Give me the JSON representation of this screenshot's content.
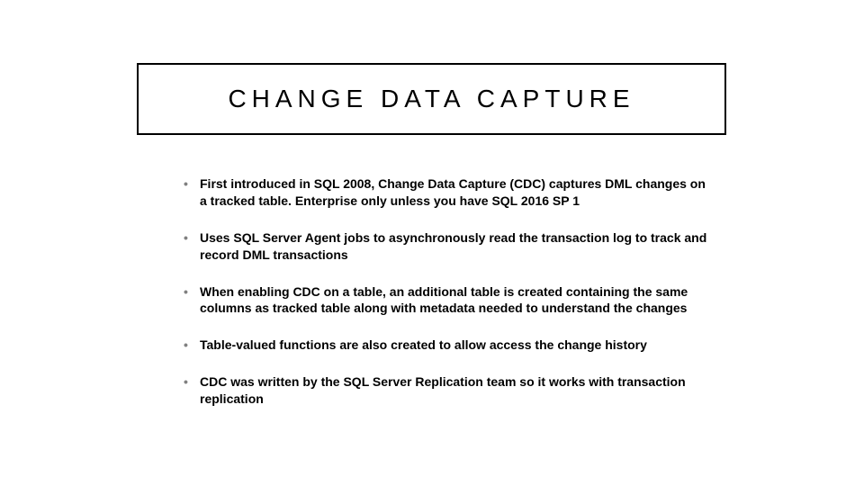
{
  "title": "CHANGE DATA CAPTURE",
  "bullets": [
    "First introduced in SQL 2008, Change Data Capture (CDC) captures DML changes on a tracked table.  Enterprise only unless you have SQL 2016 SP 1",
    "Uses SQL Server Agent jobs to asynchronously read the transaction log to track and record DML transactions",
    "When enabling CDC on a table, an additional table is created containing the same columns as tracked table along with metadata needed to understand the changes",
    "Table-valued functions are also created to allow access the change history",
    "CDC was written by the SQL Server Replication team so it works with transaction replication"
  ]
}
